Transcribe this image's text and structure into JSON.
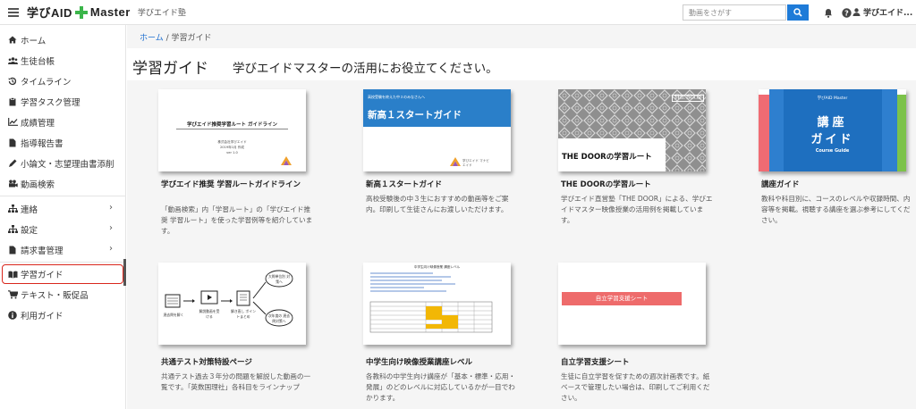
{
  "header": {
    "logo_left": "学びAID",
    "logo_right": "Master",
    "org": "学びエイド塾",
    "search_placeholder": "動画をさがす",
    "user_name": "学びエイド..."
  },
  "sidebar": {
    "items": [
      {
        "label": "ホーム",
        "icon": "home-icon"
      },
      {
        "label": "生徒台帳",
        "icon": "users-icon"
      },
      {
        "label": "タイムライン",
        "icon": "history-icon"
      },
      {
        "label": "学習タスク管理",
        "icon": "clipboard-icon"
      },
      {
        "label": "成績管理",
        "icon": "chart-icon"
      },
      {
        "label": "指導報告書",
        "icon": "document-icon"
      },
      {
        "label": "小論文・志望理由書添削",
        "icon": "pen-icon"
      },
      {
        "label": "動画検索",
        "icon": "video-icon"
      },
      {
        "label": "連絡",
        "icon": "sitemap-icon"
      },
      {
        "label": "設定",
        "icon": "settings-icon"
      },
      {
        "label": "請求書管理",
        "icon": "invoice-icon"
      },
      {
        "label": "学習ガイド",
        "icon": "book-icon"
      },
      {
        "label": "テキスト・販促品",
        "icon": "cart-icon"
      },
      {
        "label": "利用ガイド",
        "icon": "info-icon"
      }
    ]
  },
  "breadcrumb": {
    "home": "ホーム",
    "sep": "/",
    "current": "学習ガイド"
  },
  "page": {
    "title": "学習ガイド",
    "subtitle": "学びエイドマスターの活用にお役立てください。"
  },
  "cards": [
    {
      "title": "学びエイド推奨 学習ルートガイドライン",
      "desc": "「動画検索」内「学習ルート」の「学びエイド推奨 学習ルート」を使った学習例等を紹介しています。",
      "thumb": {
        "heading": "学びエイド推奨学習ルート ガイドライン",
        "meta1": "株式会社学びエイド",
        "meta2": "2019年1月 作成",
        "meta3": "ver 1.0"
      }
    },
    {
      "title": "新高１スタートガイド",
      "desc": "高校受験後の中３生におすすめの動画等をご案内。印刷して生徒さんにお渡しいただけます。",
      "thumb": {
        "kicker": "高校受験を終えた中３のみなさんへ",
        "heading": "新高１スタートガイド",
        "brand": "学びエイド マナビエイド"
      }
    },
    {
      "title": "THE DOORの学習ルート",
      "desc": "学びエイド直営塾「THE DOOR」による、学びエイドマスター映像授業の活用例を掲載しています。",
      "thumb": {
        "logo": "THE DOOR",
        "heading": "THE DOORの学習ルート"
      }
    },
    {
      "title": "講座ガイド",
      "desc": "教科や科目別に、コースのレベルや収録時間、内容等を掲載。視聴する講座を選ぶ参考にしてください。",
      "thumb": {
        "brand": "学びAID Master",
        "heading1": "講座",
        "heading2": "ガイド",
        "sub": "Course Guide"
      }
    },
    {
      "title": "共通テスト対策特設ページ",
      "desc": "共通テスト過去３年分の問題を解説した動画の一覧です。「英数国理社」各科目をラインナップ",
      "thumb": {
        "step1": "過去問を解く",
        "step2": "解説動画を受ける",
        "step3": "解き直し ポイントまとめ",
        "step4": "大問単位別 対策へ",
        "step5": "次年度の 過去問対策へ"
      }
    },
    {
      "title": "中学生向け映像授業講座レベル",
      "desc": "各教科の中学生向け講座が「基本・標準・応用・発展」のどのレベルに対応しているかが一目でわかります。",
      "thumb": {
        "heading": "中学生向け映像授業 講座レベル"
      }
    },
    {
      "title": "自立学習支援シート",
      "desc": "生徒に自立学習を促すための週次計画表です。紙ベースで管理したい場合は、印刷してご利用ください。",
      "thumb": {
        "banner": "自立学習支援シート"
      }
    }
  ],
  "colors": {
    "accent": "#1e7bd8",
    "brand_green": "#3bb54a",
    "highlight_red": "#d9261c",
    "banner_red": "#ee6b6b"
  }
}
